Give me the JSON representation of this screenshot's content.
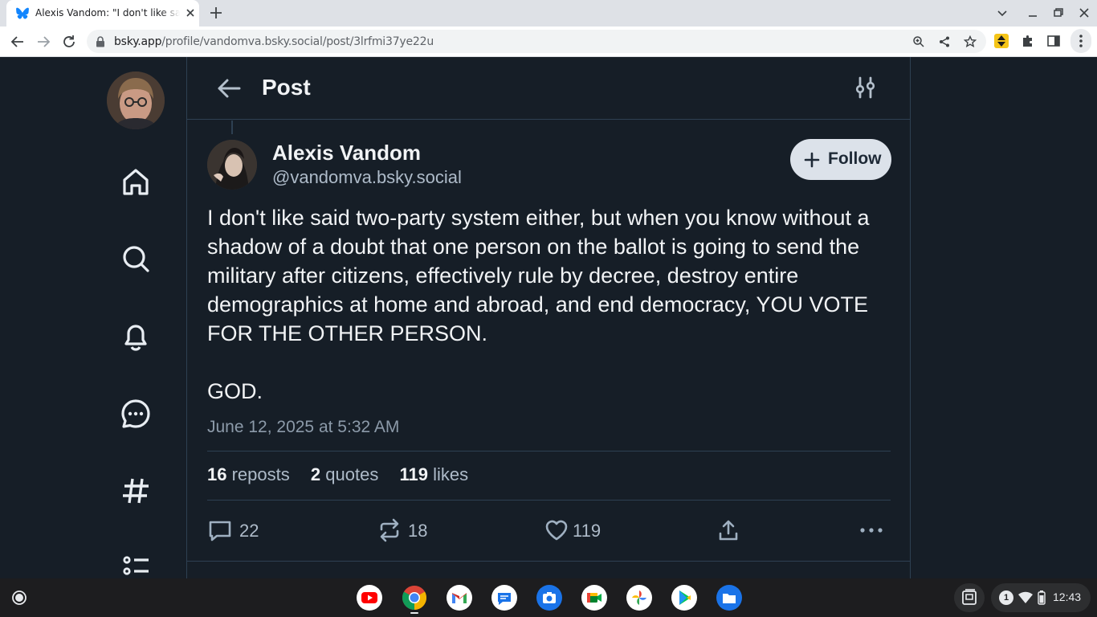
{
  "browser": {
    "tab_title": "Alexis Vandom: \"I don't like said two-party system either...",
    "url_host": "bsky.app",
    "url_path": "/profile/vandomva.bsky.social/post/3lrfmi37ye22u"
  },
  "header": {
    "title": "Post"
  },
  "post": {
    "author_name": "Alexis Vandom",
    "author_handle": "@vandomva.bsky.social",
    "follow_label": "Follow",
    "text_paragraph_1": "I don't like said two-party system either, but when you know without a shadow of a doubt that one person on the ballot is going to send the military after citizens, effectively rule by decree, destroy entire demographics at home and abroad, and end democracy, YOU VOTE FOR THE OTHER PERSON.",
    "text_paragraph_2": "GOD.",
    "timestamp": "June 12, 2025 at 5:32 AM",
    "stats": {
      "reposts_count": "16",
      "reposts_label": "reposts",
      "quotes_count": "2",
      "quotes_label": "quotes",
      "likes_count": "119",
      "likes_label": "likes"
    },
    "actions": {
      "reply_count": "22",
      "repost_count": "18",
      "like_count": "119"
    }
  },
  "sidebar": {
    "icons": [
      "home-icon",
      "search-icon",
      "bell-icon",
      "chat-icon",
      "hashtag-icon",
      "lists-icon"
    ]
  },
  "shelf": {
    "apps": [
      "youtube",
      "chrome",
      "gmail",
      "messages",
      "camera",
      "meet",
      "photos",
      "play-store",
      "files"
    ],
    "notification_count": "1",
    "clock": "12:43"
  },
  "colors": {
    "background": "#161e27",
    "border": "#2e4052",
    "text": "#f1f3f5",
    "muted": "#aebbc9",
    "follow_bg": "#dce2ea"
  }
}
